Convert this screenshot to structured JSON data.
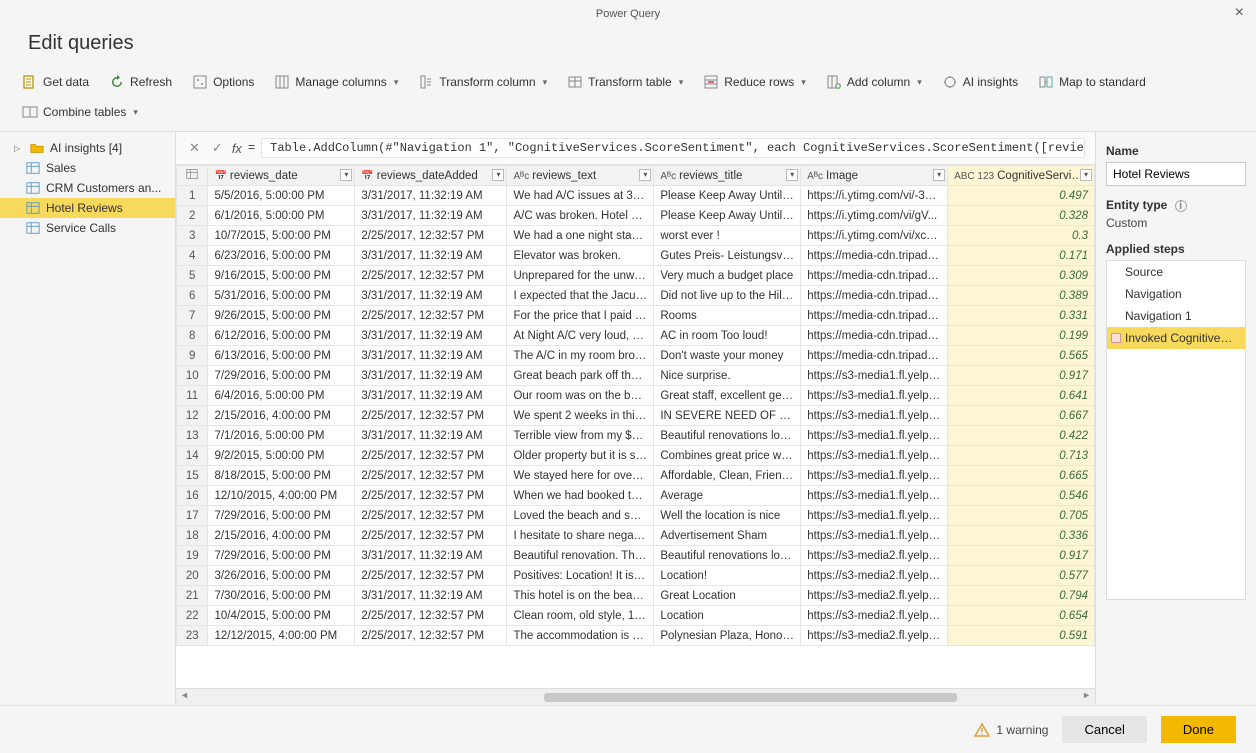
{
  "window": {
    "title": "Power Query"
  },
  "header": {
    "title": "Edit queries"
  },
  "ribbon": {
    "get_data": "Get data",
    "refresh": "Refresh",
    "options": "Options",
    "manage_columns": "Manage columns",
    "transform_column": "Transform column",
    "transform_table": "Transform table",
    "reduce_rows": "Reduce rows",
    "add_column": "Add column",
    "ai_insights": "AI insights",
    "map_to_standard": "Map to standard",
    "combine_tables": "Combine tables"
  },
  "sidebar": {
    "folder": "AI insights [4]",
    "items": [
      "Sales",
      "CRM Customers an...",
      "Hotel Reviews",
      "Service Calls"
    ],
    "selected_index": 2
  },
  "formula": {
    "eq": "=",
    "text": "Table.AddColumn(#\"Navigation 1\", \"CognitiveServices.ScoreSentiment\", each CognitiveServices.ScoreSentiment([reviews_text], \"en\"))"
  },
  "columns": [
    {
      "type": "📅",
      "name": "reviews_date"
    },
    {
      "type": "📅",
      "name": "reviews_dateAdded"
    },
    {
      "type": "Aᴮc",
      "name": "reviews_text"
    },
    {
      "type": "Aᴮc",
      "name": "reviews_title"
    },
    {
      "type": "Aᴮc",
      "name": "Image"
    },
    {
      "type": "ABC 123",
      "name": "CognitiveServices...."
    }
  ],
  "rows_index_start": 1,
  "rows": [
    [
      "5/5/2016, 5:00:00 PM",
      "3/31/2017, 11:32:19 AM",
      "We had A/C issues at 3:30 ...",
      "Please Keep Away Until Co...",
      "https://i.ytimg.com/vi/-3sD...",
      "0.497"
    ],
    [
      "6/1/2016, 5:00:00 PM",
      "3/31/2017, 11:32:19 AM",
      "A/C was broken. Hotel was...",
      "Please Keep Away Until Co...",
      "https://i.ytimg.com/vi/gV...",
      "0.328"
    ],
    [
      "10/7/2015, 5:00:00 PM",
      "2/25/2017, 12:32:57 PM",
      "We had a one night stay at...",
      "worst ever !",
      "https://i.ytimg.com/vi/xcEB...",
      "0.3"
    ],
    [
      "6/23/2016, 5:00:00 PM",
      "3/31/2017, 11:32:19 AM",
      "Elevator was broken.",
      "Gutes Preis- Leistungsverh...",
      "https://media-cdn.tripadvi...",
      "0.171"
    ],
    [
      "9/16/2015, 5:00:00 PM",
      "2/25/2017, 12:32:57 PM",
      "Unprepared for the unwelc...",
      "Very much a budget place",
      "https://media-cdn.tripadvi...",
      "0.309"
    ],
    [
      "5/31/2016, 5:00:00 PM",
      "3/31/2017, 11:32:19 AM",
      "I expected that the Jacuzzi ...",
      "Did not live up to the Hilto...",
      "https://media-cdn.tripadvi...",
      "0.389"
    ],
    [
      "9/26/2015, 5:00:00 PM",
      "2/25/2017, 12:32:57 PM",
      "For the price that I paid for...",
      "Rooms",
      "https://media-cdn.tripadvi...",
      "0.331"
    ],
    [
      "6/12/2016, 5:00:00 PM",
      "3/31/2017, 11:32:19 AM",
      "At Night A/C very loud, als...",
      "AC in room Too loud!",
      "https://media-cdn.tripadvi...",
      "0.199"
    ],
    [
      "6/13/2016, 5:00:00 PM",
      "3/31/2017, 11:32:19 AM",
      "The A/C in my room broke...",
      "Don't waste your money",
      "https://media-cdn.tripadvi...",
      "0.565"
    ],
    [
      "7/29/2016, 5:00:00 PM",
      "3/31/2017, 11:32:19 AM",
      "Great beach park off the la...",
      "Nice surprise.",
      "https://s3-media1.fl.yelpcd...",
      "0.917"
    ],
    [
      "6/4/2016, 5:00:00 PM",
      "3/31/2017, 11:32:19 AM",
      "Our room was on the bott...",
      "Great staff, excellent getaw...",
      "https://s3-media1.fl.yelpcd...",
      "0.641"
    ],
    [
      "2/15/2016, 4:00:00 PM",
      "2/25/2017, 12:32:57 PM",
      "We spent 2 weeks in this h...",
      "IN SEVERE NEED OF UPDA...",
      "https://s3-media1.fl.yelpcd...",
      "0.667"
    ],
    [
      "7/1/2016, 5:00:00 PM",
      "3/31/2017, 11:32:19 AM",
      "Terrible view from my $300...",
      "Beautiful renovations locat...",
      "https://s3-media1.fl.yelpcd...",
      "0.422"
    ],
    [
      "9/2/2015, 5:00:00 PM",
      "2/25/2017, 12:32:57 PM",
      "Older property but it is su...",
      "Combines great price with ...",
      "https://s3-media1.fl.yelpcd...",
      "0.713"
    ],
    [
      "8/18/2015, 5:00:00 PM",
      "2/25/2017, 12:32:57 PM",
      "We stayed here for over a ...",
      "Affordable, Clean, Friendly ...",
      "https://s3-media1.fl.yelpcd...",
      "0.665"
    ],
    [
      "12/10/2015, 4:00:00 PM",
      "2/25/2017, 12:32:57 PM",
      "When we had booked this ...",
      "Average",
      "https://s3-media1.fl.yelpcd...",
      "0.546"
    ],
    [
      "7/29/2016, 5:00:00 PM",
      "2/25/2017, 12:32:57 PM",
      "Loved the beach and service",
      "Well the location is nice",
      "https://s3-media1.fl.yelpcd...",
      "0.705"
    ],
    [
      "2/15/2016, 4:00:00 PM",
      "2/25/2017, 12:32:57 PM",
      "I hesitate to share negative...",
      "Advertisement Sham",
      "https://s3-media1.fl.yelpcd...",
      "0.336"
    ],
    [
      "7/29/2016, 5:00:00 PM",
      "3/31/2017, 11:32:19 AM",
      "Beautiful renovation. The h...",
      "Beautiful renovations locat...",
      "https://s3-media2.fl.yelpcd...",
      "0.917"
    ],
    [
      "3/26/2016, 5:00:00 PM",
      "2/25/2017, 12:32:57 PM",
      "Positives: Location! It is on ...",
      "Location!",
      "https://s3-media2.fl.yelpcd...",
      "0.577"
    ],
    [
      "7/30/2016, 5:00:00 PM",
      "3/31/2017, 11:32:19 AM",
      "This hotel is on the beach ...",
      "Great Location",
      "https://s3-media2.fl.yelpcd...",
      "0.794"
    ],
    [
      "10/4/2015, 5:00:00 PM",
      "2/25/2017, 12:32:57 PM",
      "Clean room, old style, 196...",
      "Location",
      "https://s3-media2.fl.yelpcd...",
      "0.654"
    ],
    [
      "12/12/2015, 4:00:00 PM",
      "2/25/2017, 12:32:57 PM",
      "The accommodation is bas...",
      "Polynesian Plaza, Honolulu",
      "https://s3-media2.fl.yelpcd...",
      "0.591"
    ]
  ],
  "right": {
    "name_label": "Name",
    "name_value": "Hotel Reviews",
    "entity_label": "Entity type",
    "entity_value": "Custom",
    "steps_label": "Applied steps",
    "steps": [
      "Source",
      "Navigation",
      "Navigation 1",
      "Invoked CognitiveSer..."
    ],
    "steps_selected": 3
  },
  "footer": {
    "warning": "1 warning",
    "cancel": "Cancel",
    "done": "Done"
  }
}
